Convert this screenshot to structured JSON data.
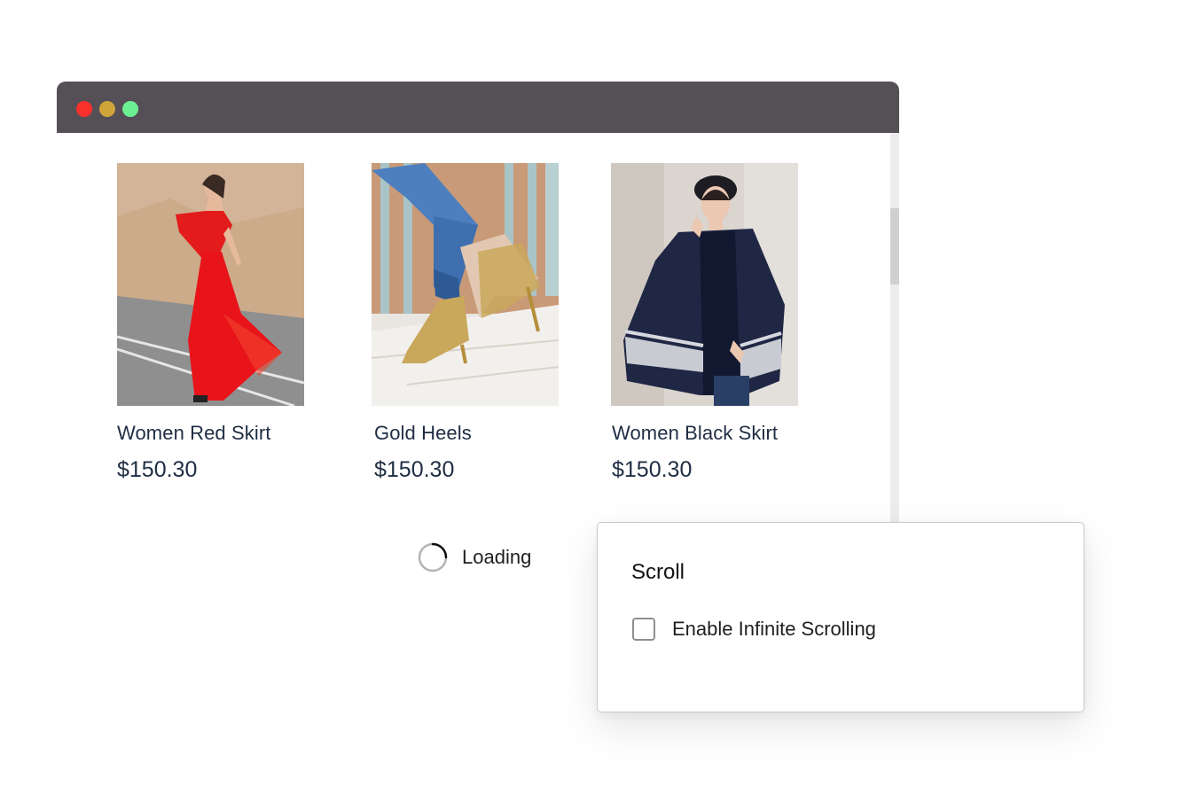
{
  "window": {
    "controls": [
      "close",
      "minimize",
      "maximize"
    ],
    "colors": {
      "titlebar": "#554f56",
      "close": "#f8312c",
      "minimize": "#cfa53a",
      "maximize": "#6cf192"
    }
  },
  "products": [
    {
      "name": "Women Red Skirt",
      "price": "$150.30"
    },
    {
      "name": "Gold Heels",
      "price": "$150.30"
    },
    {
      "name": "Women Black Skirt",
      "price": "$150.30"
    }
  ],
  "loading": {
    "label": "Loading"
  },
  "settings": {
    "title": "Scroll",
    "infinite_scrolling": {
      "label": "Enable Infinite Scrolling",
      "checked": false
    }
  }
}
